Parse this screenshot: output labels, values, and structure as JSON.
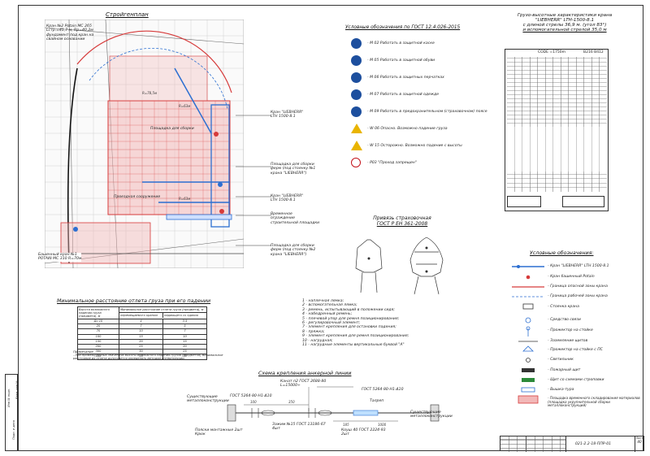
{
  "plan": {
    "title": "Стройгенплан",
    "labels": [
      "Кран №2 Potain MC 265",
      "Lстр.=41,7 м, Rр=40,2м",
      "фундамент под кран на",
      "свайном основании",
      "Кран \"LIEBHERR\"",
      "LTH 1500-8.1",
      "Площадка для сборки",
      "ферм (под стоянку №1",
      "крана \"LIEBHERR\")",
      "Кран \"LIEBHERR\"",
      "LTH 1500-8.1",
      "Временное",
      "ограждение",
      "строительной площадки",
      "Площадка для сборки",
      "ферм (под стоянку №2",
      "крана \"LIEBHERR\")",
      "Башенный кран №1",
      "POTAIN MC 310 R=70м",
      "Площадка для сборки",
      "Проездная сооружение"
    ],
    "dims": [
      "R=63м",
      "R=78,5м",
      "R=63м"
    ]
  },
  "legend_gost": {
    "title": "Условные обозначения по ГОСТ 12.4.026-2015",
    "items": [
      {
        "icon": "helmet-icon",
        "text": "- М 02 Работать в защитной каске"
      },
      {
        "icon": "boots-icon",
        "text": "- М 05 Работать в защитной обуви"
      },
      {
        "icon": "gloves-icon",
        "text": "- М 06 Работать в защитных перчатках"
      },
      {
        "icon": "clothing-icon",
        "text": "- М 07 Работать в защитной одежде"
      },
      {
        "icon": "harness-icon",
        "text": "- М 09 Работать в предохранительном (страховочном) поясе"
      },
      {
        "icon": "falling-load-icon",
        "text": "- W 06 Опасно. Возможно падение груза"
      },
      {
        "icon": "fall-hazard-icon",
        "text": "- W 15 Осторожно. Возможно падение с высоты"
      },
      {
        "icon": "no-entry-icon",
        "text": "- Р03 \"Проход запрещен\""
      }
    ]
  },
  "crane_chart": {
    "title_lines": [
      "Грузо-высотные характеристики крана",
      "\"LIEBHERR\" LTH-1500-8.1",
      "с длиной стрелы 36,9 м. (угол 83°)",
      "и вспомогательной стрелой 35,0 м"
    ],
    "header": "CODE =1750m",
    "code": "В216 В412"
  },
  "harness": {
    "title_lines": [
      "Привязь страховочная",
      "ГОСТ Р ЕН 361-2008"
    ],
    "parts": [
      "1 - наплечная лямка;",
      "2 - вспомогательная лямка;",
      "3 - ремень, испытывающий в положении сидя;",
      "4 - набедренный ремень;",
      "5 - плечевой упор для ремня позиционирования;",
      "6 - регулировочный элемент;",
      "7 - элемент крепления для остановки падения;",
      "8 - пряжка;",
      "9 - элемент крепления для ремня позиционирования;",
      "10 - нагрудная;",
      "11 - нагрудные элементы вертикальные буквой \"А\""
    ]
  },
  "legend_right": {
    "title": "Условные обозначения:",
    "items": [
      "- Кран \"LIEBHERR\" LTH 1500-8.1",
      "- Кран башенный Potain",
      "- Граница опасной зоны крана",
      "- Граница рабочей зоны крана",
      "- Стоянка крана",
      "- Средство связи",
      "- Прожектор на стойке",
      "- Заземление щитов",
      "- Прожектор на стойке с ПС",
      "- Светильник",
      "- Пожарный щит",
      "- Щит со схемами строповки",
      "- Вышка-тура",
      "- Площадка временного складирования материалов (площадка укрупнительной сборки металлоконструкций)"
    ],
    "gost_marks": [
      "ГОСТ 23457"
    ]
  },
  "min_distance": {
    "title": "Минимальное расстояние отлета груза при его падении",
    "head_col1": "Высота возможного падения груза (предмета), м",
    "head_col2": "Минимальное расстояние отлета груза (предмета), м",
    "sub_a": "перемещаемого краном",
    "sub_b": "падающего со здания",
    "rows": [
      [
        "До 10",
        "4",
        "3,5"
      ],
      [
        "20",
        "7",
        "5"
      ],
      [
        "70",
        "10",
        "7"
      ],
      [
        "100",
        "15",
        "10"
      ],
      [
        "150",
        "20",
        "15"
      ],
      [
        "200",
        "25",
        "20"
      ],
      [
        "300",
        "30",
        "25"
      ],
      [
        "450",
        "35",
        "30"
      ]
    ],
    "note_title": "Примечание",
    "note": "- При промежуточных значениях высоты возможного падения грузов (предметов) минимальное расстояние их отлета допускается определять методом интерполяции."
  },
  "anchor": {
    "title": "Схема крепления анкерной линии",
    "labels": [
      "Канат п2 ГОСТ 2688-80",
      "L=15000+",
      "ГОСТ 5264-80-Н1-Δ10",
      "ГОСТ 5264-80-Н1-Δ10",
      "Талреп",
      "Существующие",
      "металлоконструкции",
      "Зажим №15 ГОСТ 13186-67",
      "4шт",
      "Коуш 40 ГОСТ 2224-93",
      "2шт",
      "Пояски монтажные 2шт",
      "Крюк",
      "Существующие",
      "металлоконструкции"
    ],
    "dims": [
      "100",
      "350",
      "350",
      "185",
      "1000"
    ]
  },
  "stamp": {
    "code": "021-2.2-18-ППР-01",
    "sheet_label": "Лист",
    "sheet_no": "40"
  },
  "strip": {
    "labels": [
      "Инв.№ подл.",
      "Подп. и дата",
      "Взам. инв.№"
    ]
  },
  "colors": {
    "plan_red": "#d63a3a",
    "plan_blue": "#2c6fd1",
    "sign_blue": "#1d4f9e",
    "sign_yellow": "#e9b400"
  }
}
